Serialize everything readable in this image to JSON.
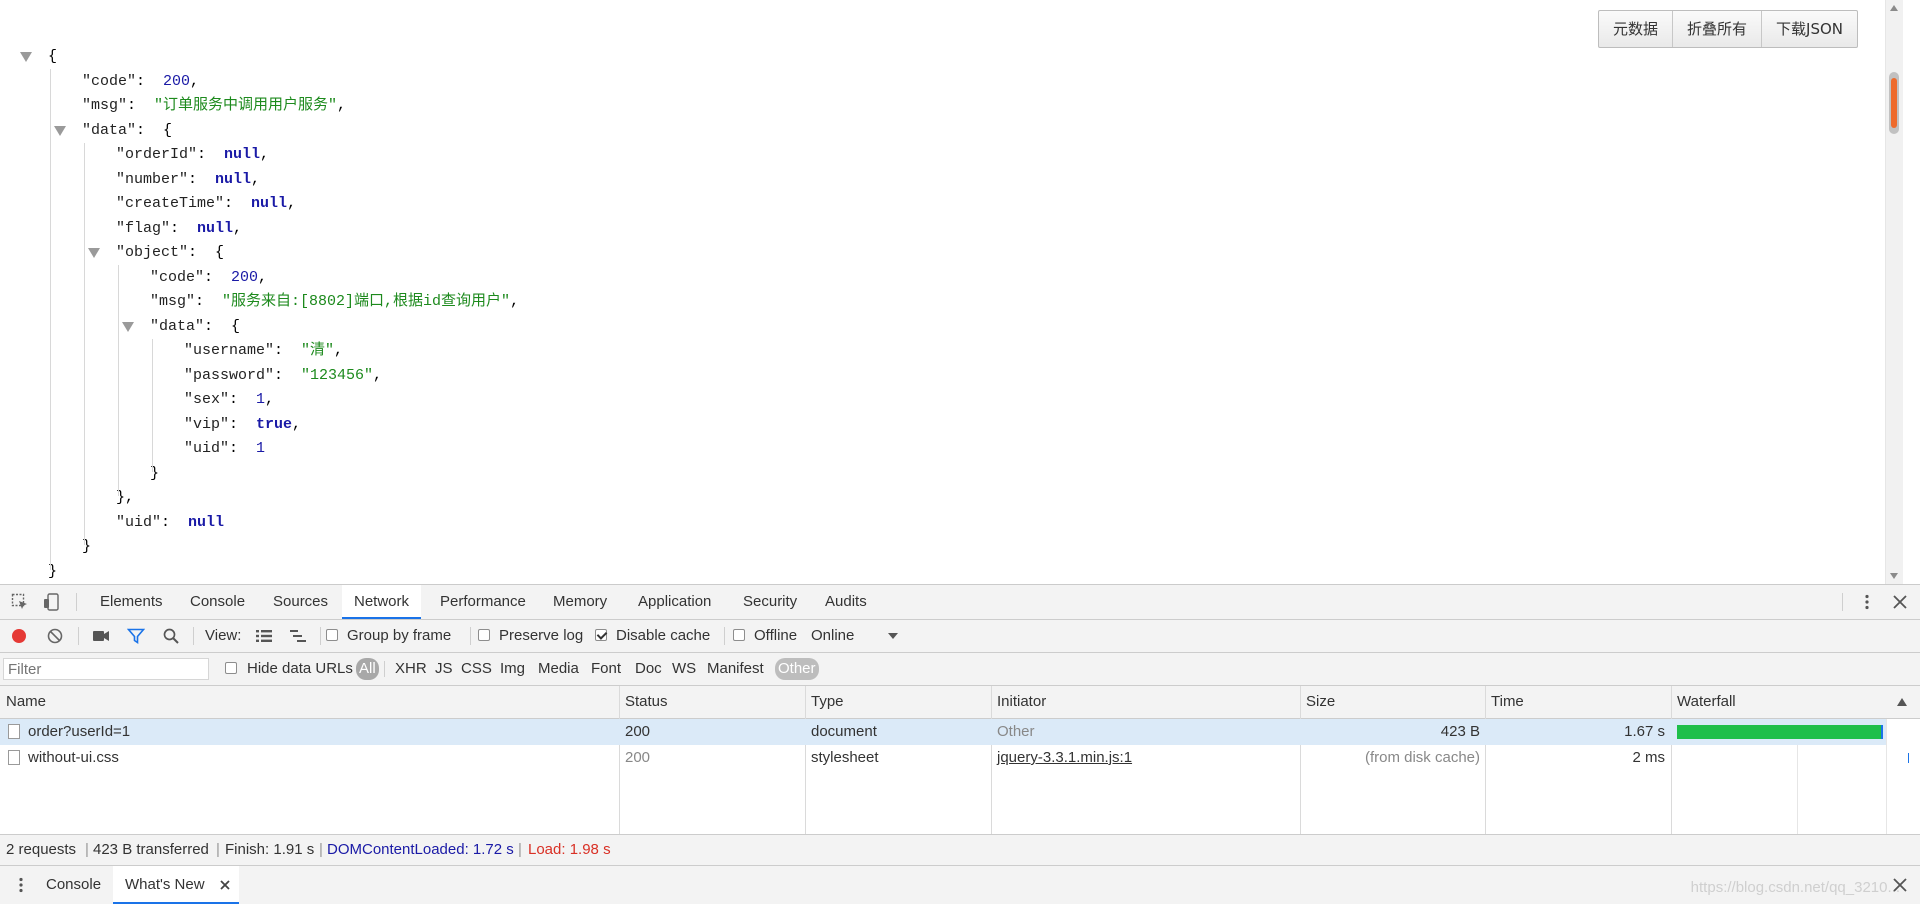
{
  "viewer": {
    "buttons": [
      "元数据",
      "折叠所有",
      "下载JSON"
    ],
    "json_lines": [
      {
        "indent": 0,
        "toggle": true,
        "parts": [
          [
            "pun",
            "{"
          ]
        ]
      },
      {
        "indent": 1,
        "parts": [
          [
            "key",
            "\"code\""
          ],
          [
            "pun",
            ":  "
          ],
          [
            "num",
            "200"
          ],
          [
            "pun",
            ","
          ]
        ]
      },
      {
        "indent": 1,
        "parts": [
          [
            "key",
            "\"msg\""
          ],
          [
            "pun",
            ":  "
          ],
          [
            "str",
            "\"订单服务中调用用户服务\""
          ],
          [
            "pun",
            ","
          ]
        ]
      },
      {
        "indent": 1,
        "toggle": true,
        "parts": [
          [
            "key",
            "\"data\""
          ],
          [
            "pun",
            ":  {"
          ]
        ]
      },
      {
        "indent": 2,
        "parts": [
          [
            "key",
            "\"orderId\""
          ],
          [
            "pun",
            ":  "
          ],
          [
            "nul",
            "null"
          ],
          [
            "pun",
            ","
          ]
        ]
      },
      {
        "indent": 2,
        "parts": [
          [
            "key",
            "\"number\""
          ],
          [
            "pun",
            ":  "
          ],
          [
            "nul",
            "null"
          ],
          [
            "pun",
            ","
          ]
        ]
      },
      {
        "indent": 2,
        "parts": [
          [
            "key",
            "\"createTime\""
          ],
          [
            "pun",
            ":  "
          ],
          [
            "nul",
            "null"
          ],
          [
            "pun",
            ","
          ]
        ]
      },
      {
        "indent": 2,
        "parts": [
          [
            "key",
            "\"flag\""
          ],
          [
            "pun",
            ":  "
          ],
          [
            "nul",
            "null"
          ],
          [
            "pun",
            ","
          ]
        ]
      },
      {
        "indent": 2,
        "toggle": true,
        "parts": [
          [
            "key",
            "\"object\""
          ],
          [
            "pun",
            ":  {"
          ]
        ]
      },
      {
        "indent": 3,
        "parts": [
          [
            "key",
            "\"code\""
          ],
          [
            "pun",
            ":  "
          ],
          [
            "num",
            "200"
          ],
          [
            "pun",
            ","
          ]
        ]
      },
      {
        "indent": 3,
        "parts": [
          [
            "key",
            "\"msg\""
          ],
          [
            "pun",
            ":  "
          ],
          [
            "str",
            "\"服务来自:[8802]端口,根据id查询用户\""
          ],
          [
            "pun",
            ","
          ]
        ]
      },
      {
        "indent": 3,
        "toggle": true,
        "parts": [
          [
            "key",
            "\"data\""
          ],
          [
            "pun",
            ":  {"
          ]
        ]
      },
      {
        "indent": 4,
        "parts": [
          [
            "key",
            "\"username\""
          ],
          [
            "pun",
            ":  "
          ],
          [
            "str",
            "\"清\""
          ],
          [
            "pun",
            ","
          ]
        ]
      },
      {
        "indent": 4,
        "parts": [
          [
            "key",
            "\"password\""
          ],
          [
            "pun",
            ":  "
          ],
          [
            "str",
            "\"123456\""
          ],
          [
            "pun",
            ","
          ]
        ]
      },
      {
        "indent": 4,
        "parts": [
          [
            "key",
            "\"sex\""
          ],
          [
            "pun",
            ":  "
          ],
          [
            "num",
            "1"
          ],
          [
            "pun",
            ","
          ]
        ]
      },
      {
        "indent": 4,
        "parts": [
          [
            "key",
            "\"vip\""
          ],
          [
            "pun",
            ":  "
          ],
          [
            "boo",
            "true"
          ],
          [
            "pun",
            ","
          ]
        ]
      },
      {
        "indent": 4,
        "parts": [
          [
            "key",
            "\"uid\""
          ],
          [
            "pun",
            ":  "
          ],
          [
            "num",
            "1"
          ]
        ]
      },
      {
        "indent": 3,
        "parts": [
          [
            "pun",
            "}"
          ]
        ]
      },
      {
        "indent": 2,
        "parts": [
          [
            "pun",
            "},"
          ]
        ]
      },
      {
        "indent": 2,
        "parts": [
          [
            "key",
            "\"uid\""
          ],
          [
            "pun",
            ":  "
          ],
          [
            "nul",
            "null"
          ]
        ]
      },
      {
        "indent": 1,
        "parts": [
          [
            "pun",
            "}"
          ]
        ]
      },
      {
        "indent": 0,
        "parts": [
          [
            "pun",
            "}"
          ]
        ]
      }
    ]
  },
  "devtools": {
    "tabs": [
      "Elements",
      "Console",
      "Sources",
      "Network",
      "Performance",
      "Memory",
      "Application",
      "Security",
      "Audits"
    ],
    "active_tab": "Network",
    "toolbar": {
      "view_label": "View:",
      "group_by_frame": "Group by frame",
      "preserve_log": "Preserve log",
      "disable_cache": "Disable cache",
      "offline": "Offline",
      "throttle": "Online"
    },
    "filter": {
      "placeholder": "Filter",
      "hide_data_urls": "Hide data URLs",
      "types": [
        "All",
        "XHR",
        "JS",
        "CSS",
        "Img",
        "Media",
        "Font",
        "Doc",
        "WS",
        "Manifest",
        "Other"
      ]
    },
    "columns": [
      "Name",
      "Status",
      "Type",
      "Initiator",
      "Size",
      "Time",
      "Waterfall"
    ],
    "rows": [
      {
        "name": "order?userId=1",
        "status": "200",
        "type": "document",
        "initiator": "Other",
        "size": "423 B",
        "time": "1.67 s"
      },
      {
        "name": "without-ui.css",
        "status": "200",
        "type": "stylesheet",
        "initiator": "jquery-3.3.1.min.js:1",
        "size": "(from disk cache)",
        "time": "2 ms"
      }
    ],
    "summary": {
      "requests": "2 requests",
      "transferred": "423 B transferred",
      "finish": "Finish: 1.91 s",
      "dcl": "DOMContentLoaded: 1.72 s",
      "load": "Load: 1.98 s"
    },
    "drawer": {
      "tabs": [
        "Console",
        "What's New"
      ],
      "active": "What's New",
      "watermark": "https://blog.csdn.net/qq_3210..."
    },
    "colors": {
      "accent": "#1a73e8",
      "dcl": "#1a1aa6",
      "load": "#d93025",
      "waterfall": "#1fbf4a"
    }
  }
}
